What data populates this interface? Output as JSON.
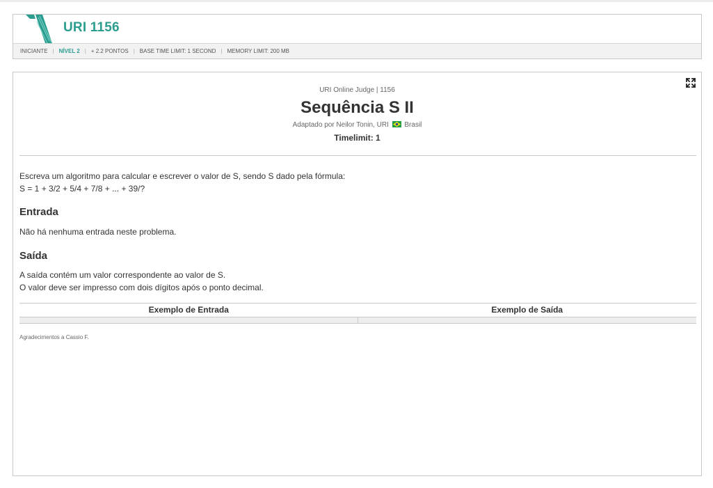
{
  "header": {
    "problem_title": "URI 1156",
    "meta": {
      "category": "INICIANTE",
      "level": "NÍVEL 2",
      "points": "+ 2.2 PONTOS",
      "time_limit": "BASE TIME LIMIT: 1 SECOND",
      "memory_limit": "MEMORY LIMIT: 200 MB"
    }
  },
  "problem": {
    "judge_line": "URI Online Judge | 1156",
    "title": "Sequência S II",
    "author_prefix": "Adaptado por Neilor Tonin, URI",
    "author_country": "Brasil",
    "timelimit": "Timelimit: 1",
    "description_line1": "Escreva um algoritmo para calcular e escrever o valor de S, sendo S dado pela fórmula:",
    "description_line2": "S = 1 + 3/2 + 5/4 + 7/8 + ... + 39/?",
    "input_heading": "Entrada",
    "input_text": "Não há nenhuma entrada neste problema.",
    "output_heading": "Saída",
    "output_line1": "A saída contém um valor correspondente ao valor de S.",
    "output_line2": "O valor deve ser impresso com dois dígitos após o ponto decimal.",
    "example_input_header": "Exemplo de Entrada",
    "example_output_header": "Exemplo de Saída",
    "example_input": "",
    "example_output": "",
    "thanks": "Agradecimentos a Cassio F."
  },
  "colors": {
    "brand": "#2a9d8f",
    "border": "#c9c9c9",
    "meta_bg": "#f2f2f2"
  },
  "icons": {
    "logo": "uri-logo-icon",
    "expand": "fullscreen-expand-icon",
    "flag": "brazil-flag-icon"
  }
}
